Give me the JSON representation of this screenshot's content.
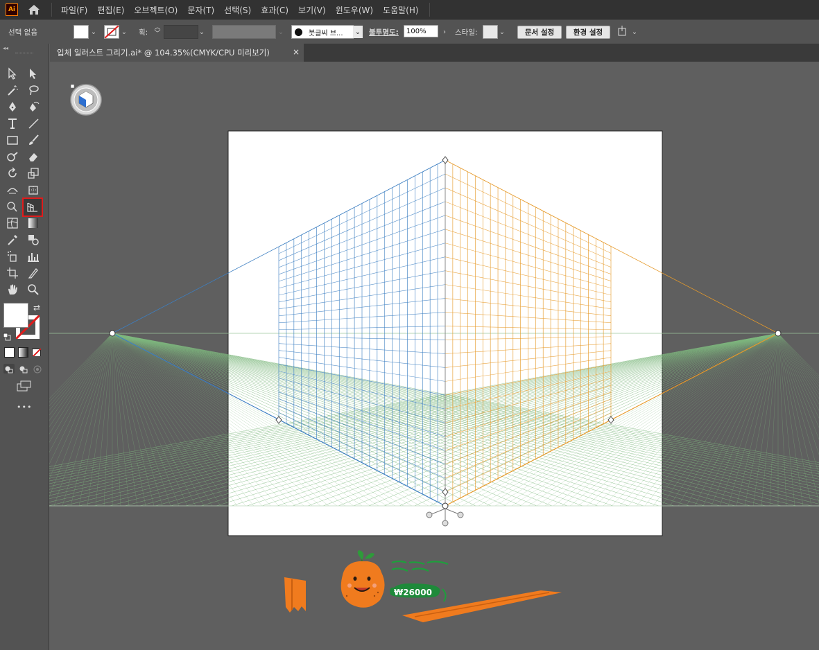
{
  "app": {
    "logo": "Ai"
  },
  "menu": [
    "파일(F)",
    "편집(E)",
    "오브젝트(O)",
    "문자(T)",
    "선택(S)",
    "효과(C)",
    "보기(V)",
    "윈도우(W)",
    "도움말(H)"
  ],
  "control": {
    "selection": "선택 없음",
    "stroke_label": "획:",
    "brush": "붓글씨 브...",
    "opacity_label": "불투명도:",
    "opacity_value": "100%",
    "style_label": "스타일:",
    "doc_setup": "문서 설정",
    "prefs": "환경 설정"
  },
  "document": {
    "tab_title": "입체 일러스트 그리기.ai* @ 104.35%(CMYK/CPU 미리보기)",
    "close": "×"
  },
  "toolbar": {
    "more": "•••",
    "collapse": "◂◂"
  },
  "artwork": {
    "price": "₩26000"
  },
  "colors": {
    "left_grid": "#3d7fc2",
    "right_grid": "#e69a2a",
    "ground_grid": "#7fb97f",
    "accent_orange": "#f07b1e",
    "selected_tool_outline": "#e01b1b"
  }
}
